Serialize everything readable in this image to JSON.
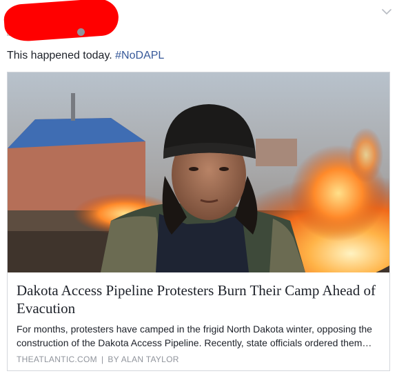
{
  "post": {
    "text_prefix": "This happened today. ",
    "hashtag": "#NoDAPL"
  },
  "header": {
    "author_redacted": true,
    "menu_icon": "chevron-down-icon",
    "audience_icon": "globe-icon"
  },
  "link_card": {
    "image_icon": "photo-protester-with-fire",
    "title": "Dakota Access Pipeline Protesters Burn Their Camp Ahead of Evacution",
    "description": "For months, protesters have camped in the frigid North Dakota winter, opposing the construction of the Dakota Access Pipeline. Recently, state officials ordered them…",
    "source": "THEATLANTIC.COM",
    "separator": "|",
    "byline": "BY ALAN TAYLOR"
  },
  "colors": {
    "hashtag": "#365899",
    "redaction": "#ff0000",
    "meta_gray": "#90949c",
    "card_border": "#d3d6db"
  }
}
